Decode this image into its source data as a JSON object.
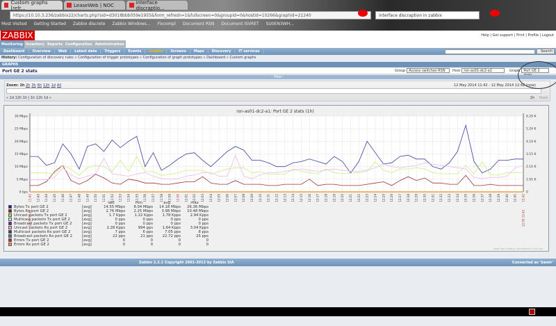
{
  "browser": {
    "tabs": [
      "Custom graphs [refr...",
      "LeaseWeb | NOC",
      "interface discraptio..."
    ],
    "url": "https://10.10.3.236/zabbix22/charts.php?sid=d3018bbb059e1955&form_refresh=1&fullscreen=0&groupid=0&hostid=10266&graphid=21240",
    "search": "interface discraption in zabbix",
    "bookmarks": [
      "Most Visited",
      "Getting Started",
      "Zabbix discrete",
      "Zabbix Windows...",
      "Fixcompl",
      "Document RSN",
      "Document ISVRET",
      "SU0EN3WH..."
    ]
  },
  "header": {
    "logo": "ZABBIX",
    "links": "Help | Get support | Print | Profile | Logout"
  },
  "menu": [
    "Monitoring",
    "Inventory",
    "Reports",
    "Configuration",
    "Administration"
  ],
  "submenu": [
    "Dashboard",
    "Overview",
    "Web",
    "Latest data",
    "Triggers",
    "Events",
    "Graphs",
    "Screens",
    "Maps",
    "Discovery",
    "IT services"
  ],
  "search_btn": "Search",
  "history": {
    "label": "History:",
    "items": [
      "Configuration of discovery rules",
      "Configuration of trigger prototypes",
      "Configuration of graph prototypes",
      "Dashboard",
      "Custom graphs"
    ]
  },
  "section": "GRAPHS",
  "page_title": "Port GE 2 stats",
  "filters": {
    "group_label": "Group",
    "group": "Access switches RSN",
    "host_label": "Host",
    "host": "rsn-as01-dc2-a1",
    "graph_label": "Graph",
    "graph": "Port GE 2 stats"
  },
  "filter_bar": "- filter -",
  "zoom": {
    "label": "Zoom:",
    "current": "1h",
    "options": [
      "2h",
      "3h",
      "6h",
      "12h",
      "1d",
      "All"
    ],
    "nav": "« 1d 12h 1h | 1h 12h 1d »",
    "range": "12 May 2014 11:42 - 12 May 2014 12:42 (now)",
    "period": "1h",
    "fixed": "fixed"
  },
  "chart_data": {
    "type": "line",
    "title": "rsn-as01-dc2-a1: Port GE 2 stats (1h)",
    "y_left": {
      "ticks": [
        "0 bps",
        "5 Mbps",
        "10 Mbps",
        "15 Mbps",
        "20 Mbps",
        "25 Mbps",
        "30 Mbps"
      ],
      "range": [
        0,
        30
      ],
      "unit": "Mbps"
    },
    "y_right": {
      "ticks": [
        "0",
        "1.05 K",
        "2.10 K",
        "3.15 K",
        "4.19 K",
        "5.24 K",
        "6.29 K"
      ],
      "range": [
        0,
        6290
      ],
      "unit": "pps"
    },
    "x_start": "12.05 11:42",
    "x_end": "12.05 12:42",
    "x": [
      "11:42",
      "11:43",
      "11:44",
      "11:45",
      "11:46",
      "11:47",
      "11:48",
      "11:49",
      "11:50",
      "11:51",
      "11:52",
      "11:53",
      "11:54",
      "11:55",
      "11:56",
      "11:57",
      "11:58",
      "11:59",
      "12:00",
      "12:01",
      "12:02",
      "12:03",
      "12:04",
      "12:05",
      "12:06",
      "12:07",
      "12:08",
      "12:09",
      "12:10",
      "12:11",
      "12:12",
      "12:13",
      "12:14",
      "12:15",
      "12:16",
      "12:17",
      "12:18",
      "12:19",
      "12:20",
      "12:21",
      "12:22",
      "12:23",
      "12:24",
      "12:25",
      "12:26",
      "12:27",
      "12:28",
      "12:29",
      "12:30",
      "12:31",
      "12:32",
      "12:33",
      "12:34",
      "12:35",
      "12:36",
      "12:37",
      "12:38",
      "12:39",
      "12:40",
      "12:41",
      "12:42"
    ],
    "series": [
      {
        "name": "Bytes Tx port GE 2",
        "axis": "left",
        "color": "#3c3ca0",
        "values": [
          14,
          14,
          10.5,
          11.5,
          19,
          15,
          9,
          18,
          19,
          16,
          20.5,
          17.5,
          20,
          22,
          10,
          15.5,
          8.5,
          10.5,
          13,
          15,
          15.5,
          12.5,
          10,
          13,
          16,
          18,
          16.5,
          12.5,
          12.5,
          11.5,
          10,
          10,
          11.5,
          12,
          13,
          12,
          11,
          14,
          12,
          7.5,
          12,
          20,
          15.5,
          11,
          11.5,
          14,
          14.5,
          13,
          13,
          10,
          9,
          11.5,
          16,
          26.4,
          12,
          7.5,
          9,
          12.5,
          12.5,
          13,
          13
        ]
      },
      {
        "name": "Bytes Rx port GE 2",
        "axis": "left",
        "color": "#a03030",
        "values": [
          2.5,
          2.5,
          4,
          8,
          10.5,
          4.5,
          3,
          4.5,
          7,
          5.5,
          3.5,
          3,
          5,
          4.5,
          3.5,
          3.5,
          3,
          3,
          3.5,
          4,
          4,
          6,
          3.5,
          3,
          3,
          4.5,
          3,
          3,
          3,
          2.5,
          2.5,
          3,
          3,
          3,
          5,
          2.5,
          3,
          3,
          2.5,
          2.5,
          2.5,
          3,
          3.5,
          4,
          2.5,
          4.5,
          6,
          4.5,
          5.5,
          3.5,
          3.5,
          3,
          3,
          6.5,
          2.5,
          2.5,
          3,
          2.5,
          2.5,
          2.5,
          2.5
        ]
      },
      {
        "name": "Unicast packets Tx port GE 2",
        "axis": "right",
        "color": "#c8ee80",
        "values": [
          1575,
          1575,
          1575,
          1470,
          2205,
          1890,
          1365,
          1995,
          2205,
          2100,
          1680,
          2625,
          1680,
          2940,
          1680,
          1680,
          1365,
          1470,
          1575,
          1785,
          1785,
          1785,
          1470,
          1680,
          1890,
          1995,
          1995,
          1575,
          1680,
          1470,
          1470,
          1470,
          1900,
          1700,
          1600,
          1500,
          1900,
          1600,
          1500,
          1550,
          1600,
          1700,
          2500,
          1800,
          1600,
          1900,
          1900,
          2000,
          1900,
          1600,
          1500,
          1500,
          1500,
          2200,
          1500,
          2500,
          1400,
          1400,
          1600,
          1600,
          1600
        ]
      },
      {
        "name": "Unicast packets Rx port GE 2",
        "axis": "right",
        "color": "#f0b8f0",
        "values": [
          1000,
          1000,
          1000,
          1200,
          2000,
          1400,
          1100,
          1300,
          1500,
          2800,
          1500,
          1400,
          1300,
          1500,
          1600,
          1300,
          1100,
          1050,
          1100,
          1300,
          1400,
          1600,
          1600,
          1300,
          1300,
          3040,
          1300,
          1100,
          1400,
          1600,
          1600,
          1700,
          1800,
          1900,
          1800,
          1700,
          1800,
          1900,
          1800,
          1700,
          1700,
          1800,
          2000,
          2300,
          2100,
          2000,
          2100,
          2200,
          2400,
          2300,
          2200,
          2100,
          2000,
          1900,
          1200,
          1100,
          1200,
          1200,
          1300,
          2000,
          2200
        ]
      },
      {
        "name": "Errors Rx port GE 2",
        "axis": "right",
        "color": "#f0a040",
        "values": [
          0
        ]
      }
    ]
  },
  "legend": {
    "headers": [
      "last",
      "min",
      "avg",
      "max"
    ],
    "rows": [
      {
        "name": "Bytes Tx port GE 2",
        "fn": "[avg]",
        "color": "#2020a0",
        "last": "14.55 Mbps",
        "min": "8.04 Mbps",
        "avg": "14.18 Mbps",
        "max": "26.36 Mbps"
      },
      {
        "name": "Bytes Rx port GE 2",
        "fn": "[avg]",
        "color": "#902020",
        "last": "2.76 Mbps",
        "min": "2.25 Mbps",
        "avg": "3.98 Mbps",
        "max": "10.48 Mbps"
      },
      {
        "name": "Unicast packets Tx port GE 2",
        "fn": "[avg]",
        "color": "#a0e040",
        "last": "1.7 Kpps",
        "min": "1.22 Kpps",
        "avg": "1.78 Kpps",
        "max": "2.94 Kpps"
      },
      {
        "name": "Multicast packets Tx port GE 2",
        "fn": "[avg]",
        "color": "#a0f0f0",
        "last": "0 pps",
        "min": "0 pps",
        "avg": "0 pps",
        "max": "0 pps"
      },
      {
        "name": "Broadcast packets Tx port GE 2",
        "fn": "[avg]",
        "color": "#802080",
        "last": "0 pps",
        "min": "0 pps",
        "avg": "0 pps",
        "max": "0 pps"
      },
      {
        "name": "Unicast packets Rx port GE 2",
        "fn": "[avg]",
        "color": "#f0b0f0",
        "last": "2.28 Kpps",
        "min": "994 pps",
        "avg": "1.64 Kpps",
        "max": "3.04 Kpps"
      },
      {
        "name": "Multicast packets Rx port GE 2",
        "fn": "[avg]",
        "color": "#404050",
        "last": "7 pps",
        "min": "6 pps",
        "avg": "7.05 pps",
        "max": "8 pps"
      },
      {
        "name": "Broadcast packets Rx port GE 2",
        "fn": "[avg]",
        "color": "#209090",
        "last": "22 pps",
        "min": "21 pps",
        "avg": "22.72 pps",
        "max": "25 pps"
      },
      {
        "name": "Errors Tx port GE 2",
        "fn": "[avg]",
        "color": "#e02020",
        "last": "0",
        "min": "0",
        "avg": "0",
        "max": "0"
      },
      {
        "name": "Errors Rx port GE 2",
        "fn": "[avg]",
        "color": "#f0a040",
        "last": "0",
        "min": "0",
        "avg": "0",
        "max": "0"
      }
    ]
  },
  "graph_note": "Data from history. Generated in 0.41 sec",
  "footer": {
    "copyright": "Zabbix 2.2.1 Copyright 2001-2013 by Zabbix SIA",
    "connected": "Connected as 'Samir'"
  }
}
